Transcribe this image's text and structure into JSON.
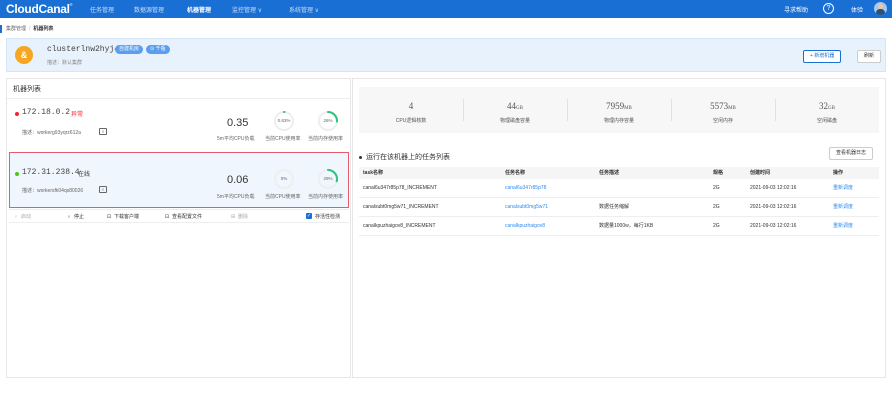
{
  "topnav": {
    "logo": "CloudCanal",
    "logo_mark": "®",
    "items": [
      "任务管理",
      "数据源管理",
      "机器管理",
      "监控管理 ∨",
      "系统管理 ∨"
    ],
    "active_index": 2,
    "help_label": "寻求帮助",
    "help_icon": "?",
    "user_label": "体验"
  },
  "breadcrumb": {
    "root": "集群管理",
    "sep": "/",
    "current": "机器列表"
  },
  "cluster": {
    "icon_text": "&",
    "name": "clusterlnw2hyj490",
    "tags": [
      "自建机房",
      "⊙ 千瓶"
    ],
    "desc": "描述：默认集群",
    "add_button": "+ 新增机器",
    "refresh_button": "刷新"
  },
  "left": {
    "title": "机器列表",
    "machines": [
      {
        "ip": "172.18.0.2",
        "status": "异常",
        "status_color": "#f5222d",
        "dot_color": "#f5222d",
        "desc": "描述：workerg93yqrz612a",
        "load": "0.35",
        "load_label": "5m平均CPU负载",
        "cpu": "0.83%",
        "cpu_fraction": 0.008,
        "cpu_label": "当前CPU使用率",
        "mem": "26%",
        "mem_fraction": 0.26,
        "mem_label": "当前内存使用率"
      },
      {
        "ip": "172.31.238.4",
        "status": "在线",
        "status_color": "#333333",
        "dot_color": "#52c41a",
        "desc": "描述：workersfk04qs80026",
        "load": "0.06",
        "load_label": "5m平均CPU负载",
        "cpu": "0%",
        "cpu_fraction": 0,
        "cpu_label": "当前CPU使用率",
        "mem": "29%",
        "mem_fraction": 0.29,
        "mem_label": "当前内存使用率"
      }
    ],
    "actions": [
      {
        "icon": "♀",
        "label": "启动",
        "disabled": true
      },
      {
        "icon": "♁",
        "label": "停止",
        "disabled": false
      },
      {
        "icon": "⊡",
        "label": "下载客户端",
        "disabled": false
      },
      {
        "icon": "⊡",
        "label": "查看配置文件",
        "disabled": false
      },
      {
        "icon": "⊞",
        "label": "删除",
        "disabled": true
      }
    ],
    "check_label": "存活性检测",
    "check_mark": "✓"
  },
  "right": {
    "stats": [
      {
        "value": "4",
        "unit": "",
        "label": "CPU逻辑核数"
      },
      {
        "value": "44",
        "unit": "GB",
        "label": "物理磁盘容量"
      },
      {
        "value": "7959",
        "unit": "MB",
        "label": "物理内存容量"
      },
      {
        "value": "5573",
        "unit": "MB",
        "label": "空闲内存"
      },
      {
        "value": "32",
        "unit": "GB",
        "label": "空闲磁盘"
      }
    ],
    "task_title": "运行在该机器上的任务列表",
    "log_button": "查看机器日志",
    "columns": [
      "task名称",
      "任务名称",
      "任务描述",
      "规格",
      "创建时间",
      "操作"
    ],
    "rows": [
      {
        "task": "canal6u347r85p78_INCREMENT",
        "name": "canal6u347r85p78",
        "desc": "",
        "spec": "2G",
        "time": "2021-09-03 12:02:16",
        "op": "重新调度"
      },
      {
        "task": "canalsubt0mg5w71_INCREMENT",
        "name": "canalsubt0mg5w71",
        "desc": "数据任务缩解",
        "spec": "2G",
        "time": "2021-09-03 12:02:16",
        "op": "重新调度"
      },
      {
        "task": "canalkpuzhaigov8_INCREMENT",
        "name": "canalkpuzhaigov8",
        "desc": "数据量1000w，每行1KB",
        "spec": "2G",
        "time": "2021-09-03 12:02:16",
        "op": "重新调度"
      }
    ]
  }
}
